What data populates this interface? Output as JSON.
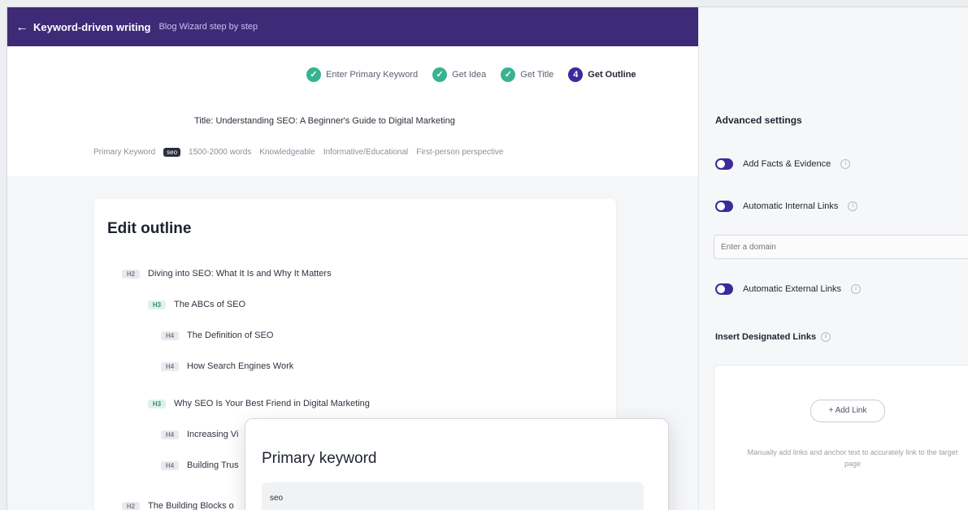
{
  "topbar": {
    "title": "Keyword-driven writing",
    "subtitle": "Blog Wizard step by step"
  },
  "steps": [
    {
      "label": "Enter Primary Keyword",
      "icon": "check-icon",
      "status": "done"
    },
    {
      "label": "Get Idea",
      "icon": "check-icon",
      "status": "done"
    },
    {
      "label": "Get Title",
      "icon": "check-icon",
      "status": "done"
    },
    {
      "label": "Get Outline",
      "icon": "number-icon",
      "number": "4",
      "status": "active"
    }
  ],
  "article": {
    "title": "Title: Understanding SEO: A Beginner's Guide to Digital Marketing",
    "meta": {
      "keyword_label": "Primary Keyword",
      "keyword_value": "seo",
      "length": "1500-2000 words",
      "tone": "Knowledgeable",
      "intent": "Informative/Educational",
      "perspective": "First-person perspective"
    }
  },
  "outline": {
    "heading": "Edit outline",
    "items": [
      {
        "tag": "H2",
        "text": "Diving into SEO: What It Is and Why It Matters"
      },
      {
        "tag": "H3",
        "text": "The ABCs of SEO"
      },
      {
        "tag": "H4",
        "text": "The Definition of SEO"
      },
      {
        "tag": "H4",
        "text": "How Search Engines Work"
      },
      {
        "tag": "H3",
        "text": "Why SEO Is Your Best Friend in Digital Marketing"
      },
      {
        "tag": "H4",
        "text": "Increasing Vi"
      },
      {
        "tag": "H4",
        "text": "Building Trus"
      },
      {
        "tag": "H2",
        "text": "The Building Blocks o"
      }
    ]
  },
  "sidebar": {
    "heading": "Advanced settings",
    "toggles": [
      {
        "label": "Add Facts & Evidence",
        "on": true
      },
      {
        "label": "Automatic Internal Links",
        "on": true
      },
      {
        "label": "Automatic External Links",
        "on": true
      }
    ],
    "domain_placeholder": "Enter a domain",
    "insert_label": "Insert Designated Links",
    "add_link": "+ Add Link",
    "link_help": "Manually add links and anchor text to accurately link to the target page"
  },
  "popover": {
    "title": "Primary keyword",
    "value": "seo"
  },
  "colors": {
    "topbar": "#3f2a78",
    "accent": "#3b2a9c",
    "done": "#37b390"
  }
}
